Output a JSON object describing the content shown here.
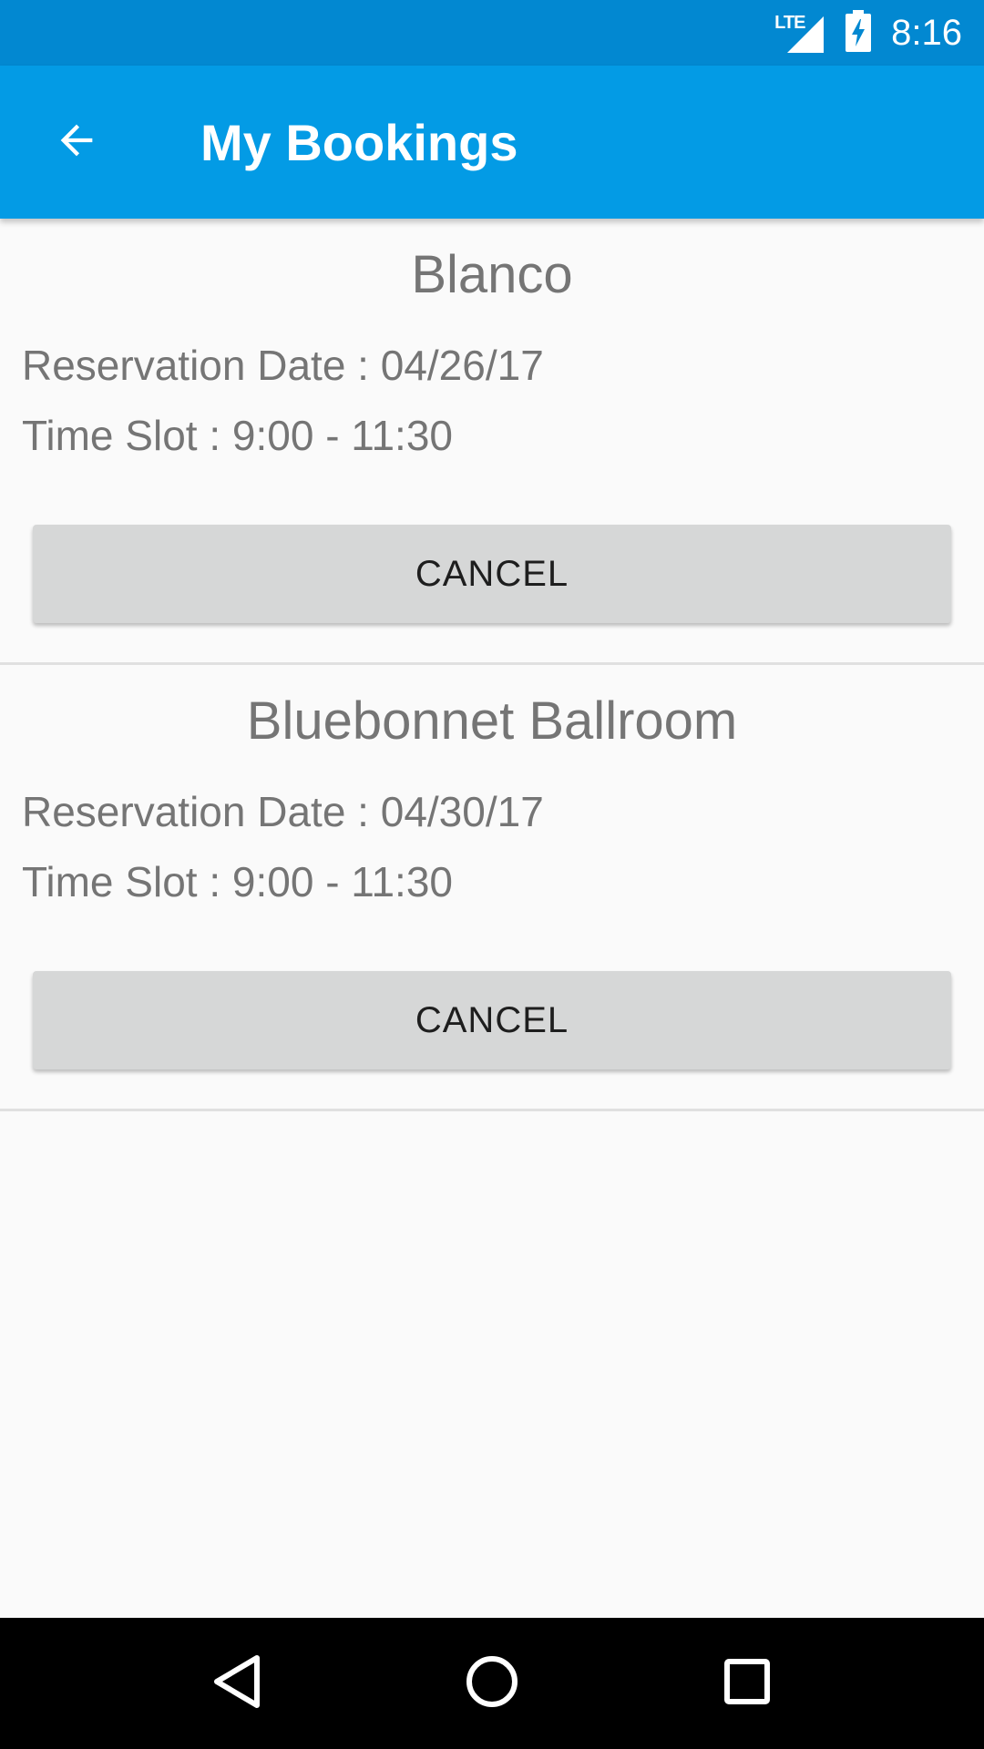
{
  "status_bar": {
    "network": "LTE",
    "time": "8:16",
    "icons": [
      "lte-signal-icon",
      "battery-charging-icon"
    ]
  },
  "app_bar": {
    "title": "My Bookings",
    "back_icon": "arrow-back-icon"
  },
  "bookings": [
    {
      "venue": "Blanco",
      "reservation_date": "Reservation Date : 04/26/17",
      "time_slot": "Time Slot : 9:00 - 11:30",
      "cancel_label": "CANCEL"
    },
    {
      "venue": "Bluebonnet Ballroom",
      "reservation_date": "Reservation Date : 04/30/17",
      "time_slot": "Time Slot : 9:00 - 11:30",
      "cancel_label": "CANCEL"
    }
  ],
  "nav_bar": {
    "icons": [
      "nav-back-icon",
      "nav-home-icon",
      "nav-recents-icon"
    ]
  },
  "colors": {
    "status_bar": "#0288d1",
    "app_bar": "#039be5",
    "button": "#d6d7d7",
    "text_secondary": "#757575"
  }
}
